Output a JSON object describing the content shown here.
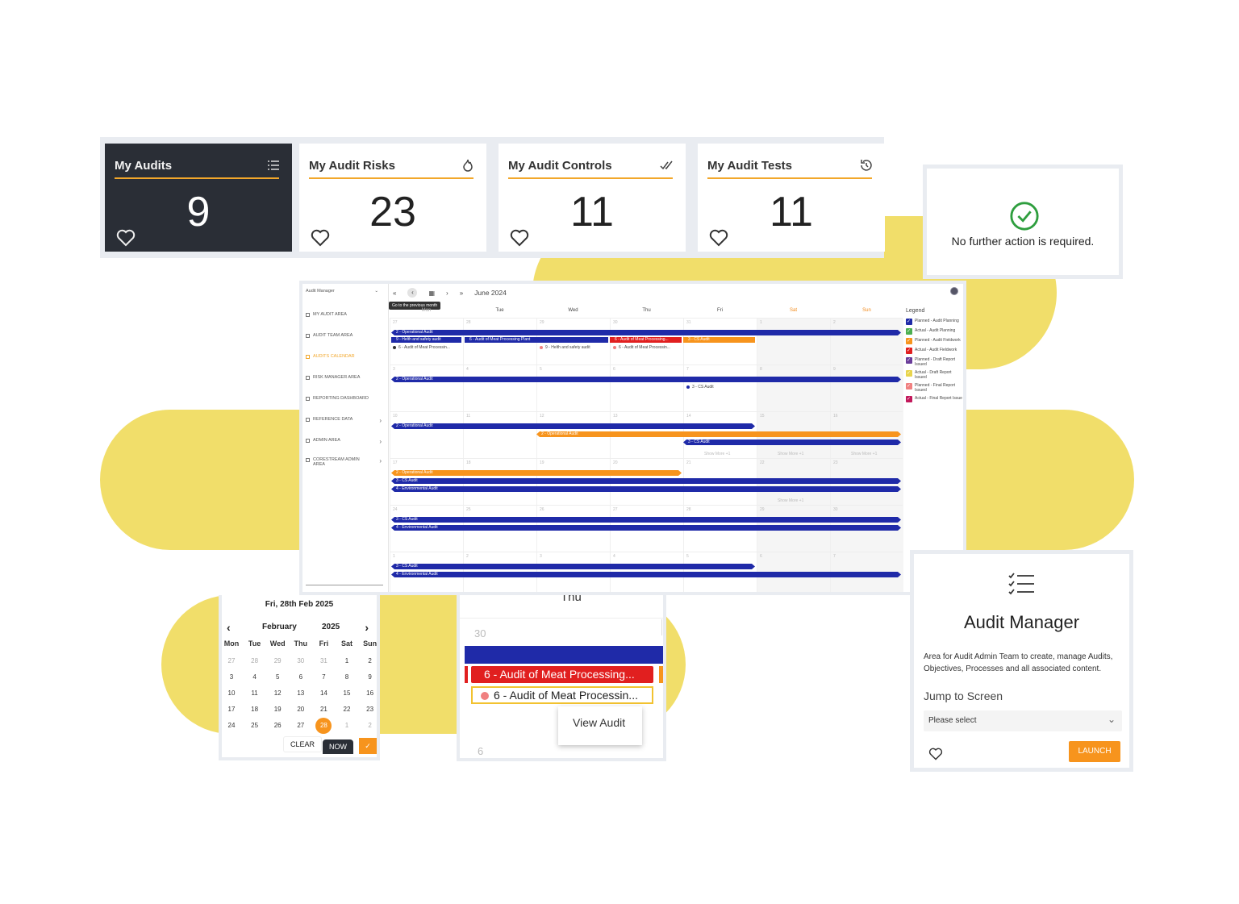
{
  "kpis": [
    {
      "title": "My Audits",
      "value": "9",
      "icon": "list-icon",
      "dark": true
    },
    {
      "title": "My Audit Risks",
      "value": "23",
      "icon": "flame-icon",
      "dark": false
    },
    {
      "title": "My Audit Controls",
      "value": "11",
      "icon": "double-check-icon",
      "dark": false
    },
    {
      "title": "My Audit Tests",
      "value": "11",
      "icon": "history-icon",
      "dark": false
    }
  ],
  "no_action": {
    "message": "No further action is required."
  },
  "calendar": {
    "role_select": "Audit Manager",
    "tooltip": "Go to the previous month",
    "month_label": "June 2024",
    "nav": [
      {
        "label": "MY AUDIT AREA",
        "active": false,
        "chevron": false
      },
      {
        "label": "AUDIT TEAM AREA",
        "active": false,
        "chevron": false
      },
      {
        "label": "AUDITS CALENDAR",
        "active": true,
        "chevron": false
      },
      {
        "label": "RISK MANAGER AREA",
        "active": false,
        "chevron": false
      },
      {
        "label": "REPORTING DASHBOARD",
        "active": false,
        "chevron": false
      },
      {
        "label": "REFERENCE DATA",
        "active": false,
        "chevron": true
      },
      {
        "label": "ADMIN AREA",
        "active": false,
        "chevron": true
      },
      {
        "label": "CORESTREAM ADMIN AREA",
        "active": false,
        "chevron": true
      }
    ],
    "days": [
      "Mon",
      "Tue",
      "Wed",
      "Thu",
      "Fri",
      "Sat",
      "Sun"
    ],
    "weeks": [
      [
        "27",
        "28",
        "29",
        "30",
        "31",
        "1",
        "2"
      ],
      [
        "3",
        "4",
        "5",
        "6",
        "7",
        "8",
        "9"
      ],
      [
        "10",
        "11",
        "12",
        "13",
        "14",
        "15",
        "16"
      ],
      [
        "17",
        "18",
        "19",
        "20",
        "21",
        "22",
        "23"
      ],
      [
        "24",
        "25",
        "26",
        "27",
        "28",
        "29",
        "30"
      ],
      [
        "1",
        "2",
        "3",
        "4",
        "5",
        "6",
        "7"
      ]
    ],
    "events": {
      "operational": "2 - Operational Audit",
      "health_bar": "9 - Helth and safety audit",
      "meat_plant": "6 - Audit of Meat Processing Plant",
      "meat_short": "6 - Audit of Meat Processing...",
      "cs_audit": "3 - CS Audit",
      "meat_dot": "6 - Audit of Meat Processin...",
      "health_dot": "9 - Helth and safety audit",
      "meat_dot2": "6 - Audit of Meat Processin...",
      "cs_dot": "3 - CS Audit",
      "environmental": "4 - Environmental Audit",
      "show_more": "Show More +1"
    },
    "legend_title": "Legend",
    "legend": [
      {
        "label": "Planned - Audit Planning",
        "color": "#1f2aa8"
      },
      {
        "label": "Actual - Audit Planning",
        "color": "#4caf50"
      },
      {
        "label": "Planned - Audit Fieldwork",
        "color": "#f7941d"
      },
      {
        "label": "Actual - Audit Fieldwork",
        "color": "#e11f1f"
      },
      {
        "label": "Planned - Draft Report Issued",
        "color": "#6a3d9a"
      },
      {
        "label": "Actual - Draft Report Issued",
        "color": "#e8d44d"
      },
      {
        "label": "Planned - Final Report Issued",
        "color": "#f08080"
      },
      {
        "label": "Actual - Final Report Issue",
        "color": "#c2185b"
      }
    ]
  },
  "datepicker": {
    "header": "Fri, 28th Feb 2025",
    "month": "February",
    "year": "2025",
    "days": [
      "Mon",
      "Tue",
      "Wed",
      "Thu",
      "Fri",
      "Sat",
      "Sun"
    ],
    "rows": [
      [
        "27",
        "28",
        "29",
        "30",
        "31",
        "1",
        "2"
      ],
      [
        "3",
        "4",
        "5",
        "6",
        "7",
        "8",
        "9"
      ],
      [
        "10",
        "11",
        "12",
        "13",
        "14",
        "15",
        "16"
      ],
      [
        "17",
        "18",
        "19",
        "20",
        "21",
        "22",
        "23"
      ],
      [
        "24",
        "25",
        "26",
        "27",
        "28",
        "1",
        "2"
      ]
    ],
    "clear_label": "CLEAR",
    "now_label": "NOW"
  },
  "zoom": {
    "day_header": "Thu",
    "date": "30",
    "event_red": "6 - Audit of Meat Processing...",
    "event_dot": "6 - Audit of Meat Processin...",
    "menu_item": "View Audit",
    "next_date": "6"
  },
  "audit_manager": {
    "title": "Audit Manager",
    "description": "Area for Audit Admin Team to create, manage Audits, Objectives, Processes and all associated content.",
    "jump_label": "Jump to Screen",
    "select_placeholder": "Please select",
    "launch_label": "LAUNCH"
  },
  "colors": {
    "accent": "#f2a72b",
    "dark_card": "#2a2e36",
    "blob": "#f1de6a",
    "success": "#2e9e3e"
  }
}
